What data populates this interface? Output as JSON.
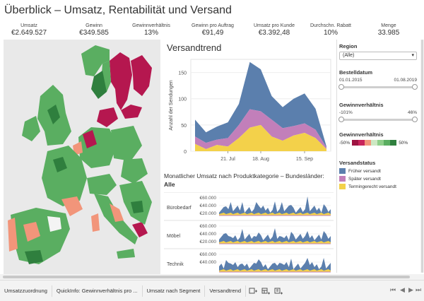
{
  "page": {
    "title": "Überblick – Umsatz, Rentabilität und Versand"
  },
  "kpis": [
    {
      "label": "Umsatz",
      "value": "€2.649.527"
    },
    {
      "label": "Gewinn",
      "value": "€349.585"
    },
    {
      "label": "Gewinnverhältnis",
      "value": "13%"
    },
    {
      "label": "Gewinn pro Auftrag",
      "value": "€91,49"
    },
    {
      "label": "Umsatz pro Kunde",
      "value": "€3.392,48"
    },
    {
      "label": "Durchschn. Rabatt",
      "value": "10%"
    },
    {
      "label": "Menge",
      "value": "33.985"
    }
  ],
  "trend": {
    "title": "Versandtrend",
    "ylabel": "Anzahl der Sendungen",
    "yticks": [
      "0",
      "50",
      "100",
      "150"
    ],
    "xticks": [
      "21. Jul",
      "18. Aug",
      "15. Sep"
    ]
  },
  "bars": {
    "title_prefix": "Monatlicher Umsatz nach Produktkategorie – Bundesländer:",
    "title_value": "Alle",
    "rows": [
      {
        "label": "Bürobedarf",
        "ticks": [
          "€60.000",
          "€40.000",
          "€20.000"
        ]
      },
      {
        "label": "Möbel",
        "ticks": [
          "€60.000",
          "€40.000",
          "€20.000"
        ]
      },
      {
        "label": "Technik",
        "ticks": [
          "€60.000",
          "€40.000"
        ]
      }
    ]
  },
  "filters": {
    "region": {
      "label": "Region",
      "value": "(Alle)"
    },
    "date": {
      "label": "Bestelldatum",
      "from": "01.01.2015",
      "to": "01.08.2019"
    },
    "ratio": {
      "label": "Gewinnverhältnis",
      "from": "-101%",
      "to": "46%"
    },
    "ratio_legend": {
      "label": "Gewinnverhältnis",
      "min": "-50%",
      "max": "50%"
    },
    "status": {
      "label": "Versandstatus",
      "items": [
        {
          "label": "Früher versandt",
          "color": "#5b7fad"
        },
        {
          "label": "Später versandt",
          "color": "#c27fba"
        },
        {
          "label": "Termingerecht versandt",
          "color": "#f3d14a"
        }
      ]
    }
  },
  "tabs": [
    "Umsatzzuordnung",
    "QuickInfo: Gewinnverhältnis pro ...",
    "Umsatz nach Segment",
    "Versandtrend"
  ],
  "colors": {
    "early": "#5b7fad",
    "late": "#c27fba",
    "ontime": "#f3d14a",
    "deep_red": "#b5174f",
    "salmon": "#f2957a",
    "green": "#5aae61",
    "dark_green": "#2f7f3e"
  },
  "chart_data": {
    "type": "area",
    "title": "Versandtrend",
    "ylabel": "Anzahl der Sendungen",
    "ylim": [
      0,
      175
    ],
    "xticks": [
      "21. Jul",
      "18. Aug",
      "15. Sep"
    ],
    "x": [
      0,
      1,
      2,
      3,
      4,
      5,
      6,
      7,
      8,
      9,
      10,
      11,
      12
    ],
    "series": [
      {
        "name": "Termingerecht versandt",
        "values": [
          14,
          4,
          12,
          9,
          25,
          45,
          50,
          28,
          20,
          30,
          35,
          25,
          4
        ]
      },
      {
        "name": "Später versandt",
        "values": [
          14,
          12,
          10,
          16,
          25,
          35,
          26,
          32,
          24,
          18,
          18,
          16,
          3
        ]
      },
      {
        "name": "Früher versandt",
        "values": [
          32,
          20,
          25,
          30,
          40,
          90,
          80,
          45,
          40,
          52,
          57,
          40,
          2
        ]
      }
    ]
  }
}
